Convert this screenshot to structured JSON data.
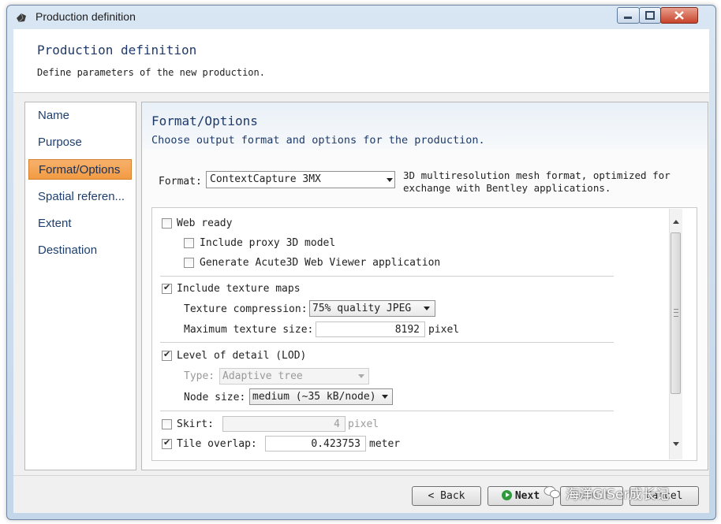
{
  "window": {
    "title": "Production definition"
  },
  "header": {
    "title": "Production definition",
    "subtitle": "Define parameters of the new production."
  },
  "nav": {
    "items": [
      {
        "label": "Name",
        "active": false
      },
      {
        "label": "Purpose",
        "active": false
      },
      {
        "label": "Format/Options",
        "active": true
      },
      {
        "label": "Spatial referen...",
        "active": false
      },
      {
        "label": "Extent",
        "active": false
      },
      {
        "label": "Destination",
        "active": false
      }
    ]
  },
  "panel": {
    "title": "Format/Options",
    "subtitle": "Choose output format and options for the production.",
    "format_label": "Format:",
    "format_value": "ContextCapture 3MX",
    "format_description": "3D multiresolution mesh format, optimized for exchange with Bentley applications."
  },
  "options": {
    "web_ready": {
      "label": "Web ready",
      "checked": false
    },
    "include_proxy": {
      "label": "Include proxy 3D model",
      "checked": false
    },
    "generate_viewer": {
      "label": "Generate Acute3D Web Viewer application",
      "checked": false
    },
    "include_texture": {
      "label": "Include texture maps",
      "checked": true
    },
    "texture_compression": {
      "label": "Texture compression:",
      "value": "75% quality JPEG"
    },
    "max_texture_size": {
      "label": "Maximum texture size:",
      "value": "8192",
      "unit": "pixel"
    },
    "lod": {
      "label": "Level of detail (LOD)",
      "checked": true
    },
    "lod_type": {
      "label": "Type:",
      "value": "Adaptive tree"
    },
    "node_size": {
      "label": "Node size:",
      "value": "medium (~35 kB/node)"
    },
    "skirt": {
      "label": "Skirt:",
      "value": "4",
      "unit": "pixel",
      "checked": false
    },
    "tile_overlap": {
      "label": "Tile overlap:",
      "value": "0.423753",
      "unit": "meter",
      "checked": true
    }
  },
  "footer": {
    "back": "< Back",
    "next": "Next",
    "submit": "Submit",
    "cancel": "Cancel"
  },
  "watermark": {
    "text": "海洋GISer成长记"
  },
  "colors": {
    "nav_active": "#f29b43",
    "accent_text": "#1f3a6a"
  }
}
